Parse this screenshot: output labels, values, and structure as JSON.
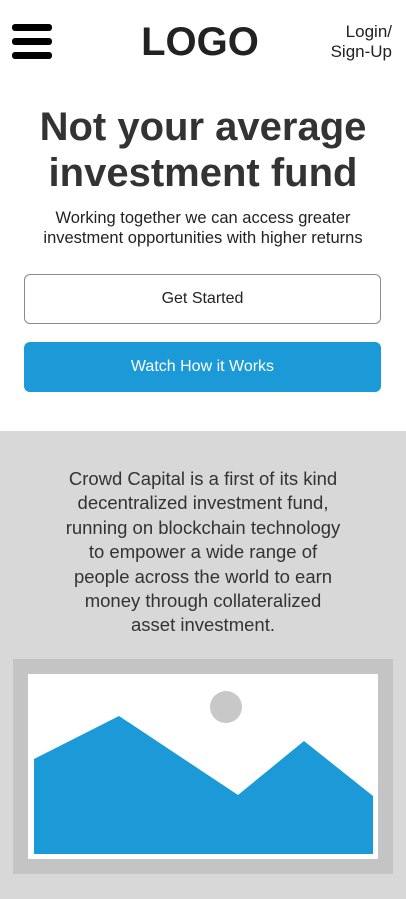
{
  "header": {
    "logo": "LOGO",
    "login_line1": "Login/",
    "login_line2": "Sign-Up"
  },
  "hero": {
    "title_line1": "Not your average",
    "title_line2": "investment fund",
    "subtitle_line1": "Working together we can access greater",
    "subtitle_line2": "investment opportunities with higher returns",
    "get_started_label": "Get Started",
    "watch_label": "Watch How it Works"
  },
  "about": {
    "lines": [
      "Crowd Capital is a first of its kind",
      "decentralized investment fund,",
      "running on blockchain technology",
      "to empower a wide range of",
      "people across the world to earn",
      "money through collateralized",
      "asset investment."
    ]
  },
  "colors": {
    "accent": "#1b9ad7",
    "section_bg": "#d8d8d8",
    "image_frame": "#c4c4c4",
    "sun": "#c8c8c8"
  },
  "icons": {
    "menu": "hamburger-menu-icon",
    "image": "image-placeholder-icon"
  }
}
